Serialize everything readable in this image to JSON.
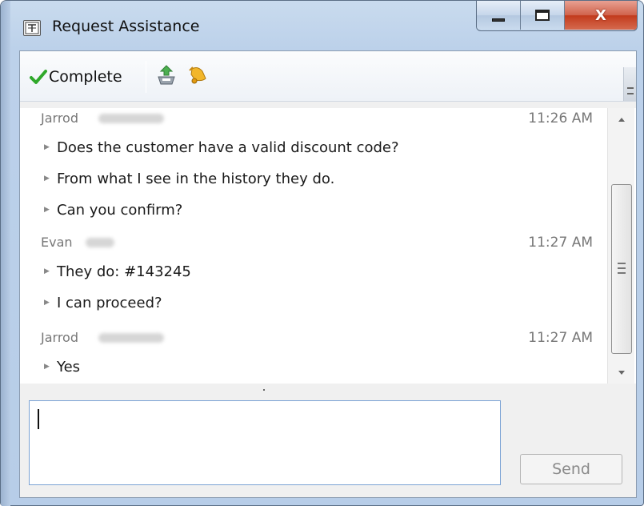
{
  "window": {
    "title": "Request Assistance",
    "close_glyph": "X"
  },
  "toolbar": {
    "complete_label": "Complete"
  },
  "messages": [
    {
      "sender": "Jarrod",
      "time": "11:26 AM",
      "lines": [
        "Does the customer have a valid discount code?",
        "From what I see in the history they do.",
        "Can you confirm?"
      ]
    },
    {
      "sender": "Evan",
      "time": "11:27 AM",
      "lines": [
        "They do: #143245",
        "I can proceed?"
      ]
    },
    {
      "sender": "Jarrod",
      "time": "11:27 AM",
      "lines": [
        "Yes"
      ]
    }
  ],
  "compose": {
    "value": "",
    "send_label": "Send"
  },
  "icons": {
    "app": "app-window-icon",
    "complete": "checkmark-icon",
    "export": "export-icon",
    "bell": "bell-icon",
    "bullet": "bullet-triangle-icon"
  },
  "colors": {
    "check": "#2fa82a",
    "bell": "#e8a41a",
    "close_button": "#c63d1f"
  }
}
